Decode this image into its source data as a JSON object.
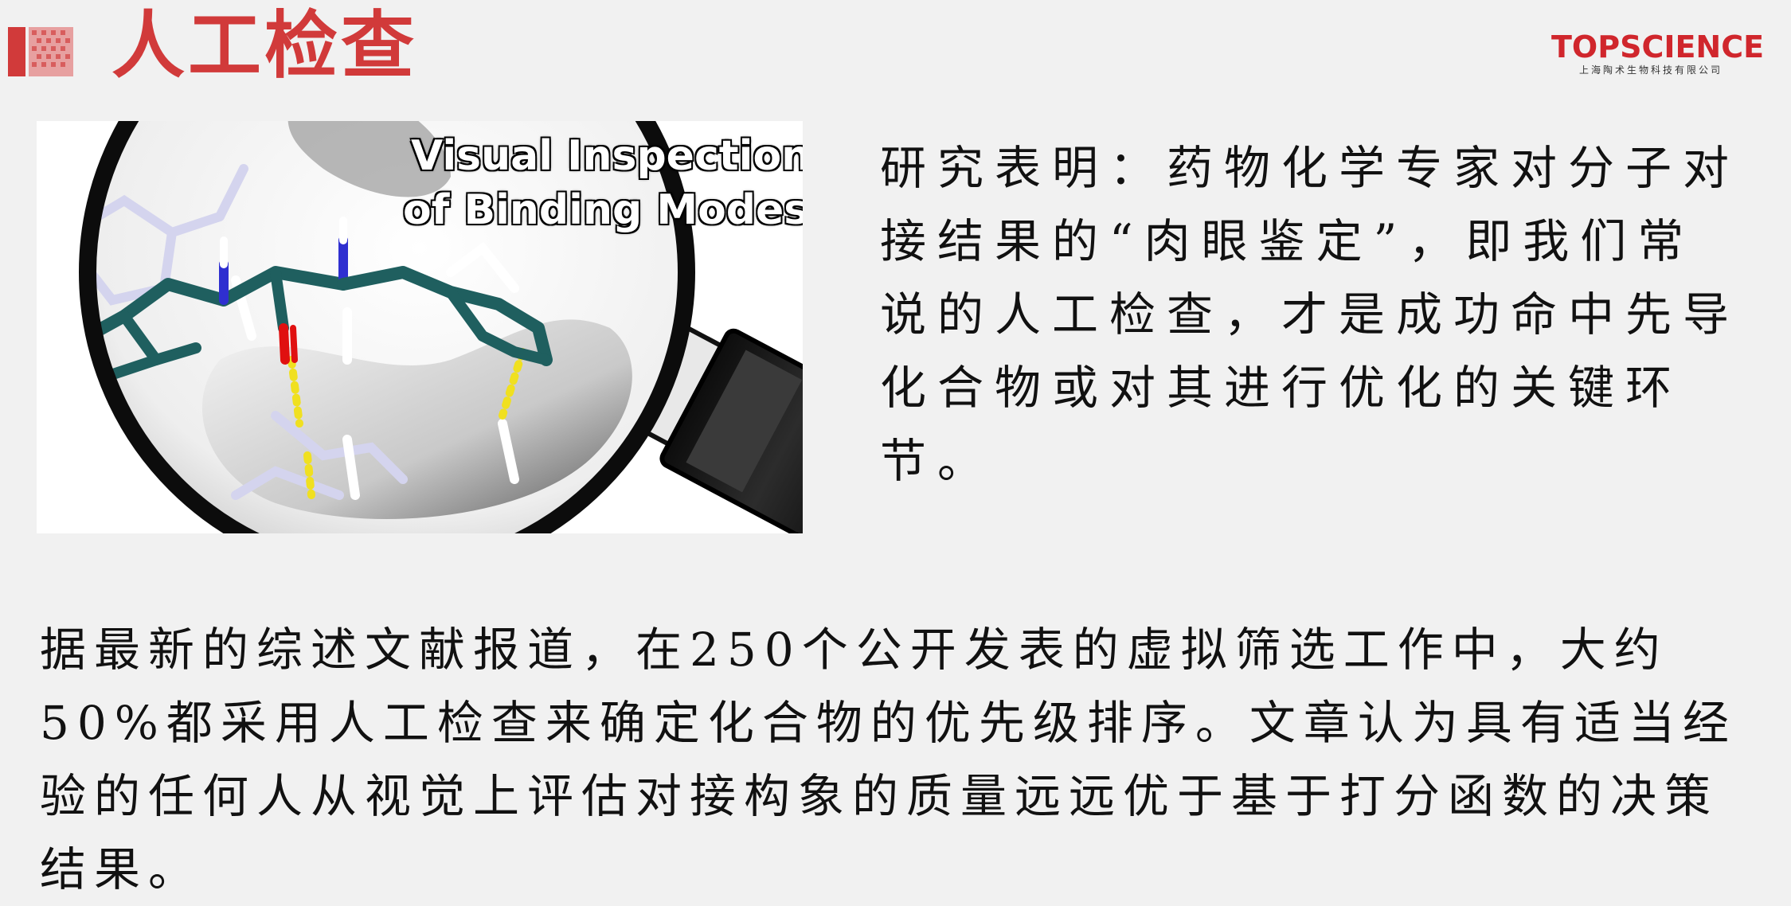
{
  "header": {
    "title": "人工检查"
  },
  "logo": {
    "brand": "TOPSCIENCE",
    "subtitle": "上海陶术生物科技有限公司"
  },
  "illustration": {
    "caption_line1": "Visual Inspection",
    "caption_line2": "of Binding Modes"
  },
  "content": {
    "right_paragraph": "研究表明：药物化学专家对分子对接结果的“肉眼鉴定”，即我们常说的人工检查，才是成功命中先导化合物或对其进行优化的关键环节。",
    "bottom_paragraph": "据最新的综述文献报道，在250个公开发表的虚拟筛选工作中，大约50%都采用人工检查来确定化合物的优先级排序。文章认为具有适当经验的任何人从视觉上评估对接构象的质量远远优于基于打分函数的决策结果。"
  },
  "colors": {
    "title": "#d13a3a",
    "brand": "#d0262c",
    "carbon": "#1f5f5f",
    "nitrogen": "#2f2fd0",
    "oxygen": "#e01010",
    "sulfur": "#e0b020",
    "hbond": "#f0e020"
  }
}
